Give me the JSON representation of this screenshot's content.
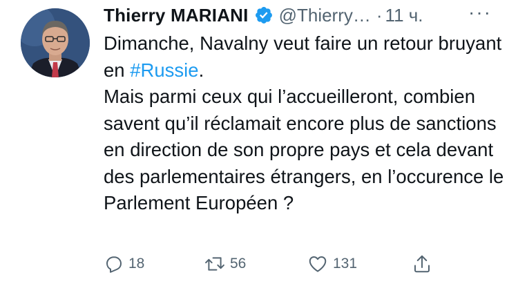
{
  "author": {
    "name": "Thierry MARIANI",
    "handle": "@Thierry…",
    "separator": "·",
    "time": "11 ч."
  },
  "icons": {
    "verified": "verified-badge-icon",
    "more": "more-horizontal-icon",
    "reply": "reply-icon",
    "retweet": "retweet-icon",
    "like": "like-icon",
    "share": "share-icon"
  },
  "more_label": "···",
  "text": {
    "line1_pre": "Dimanche, Navalny veut faire un retour bruyant en ",
    "hashtag": "#Russie",
    "line1_post": ".",
    "paragraph2": "Mais parmi ceux qui l’accueilleront, combien savent qu’il réclamait encore plus de sanctions en direction de son propre pays et cela devant des parlementaires étrangers, en l’occurence le Parlement Européen ?"
  },
  "actions": {
    "replies": "18",
    "retweets": "56",
    "likes": "131"
  },
  "colors": {
    "text": "#0f1419",
    "secondary": "#536471",
    "accent": "#1d9bf0"
  }
}
